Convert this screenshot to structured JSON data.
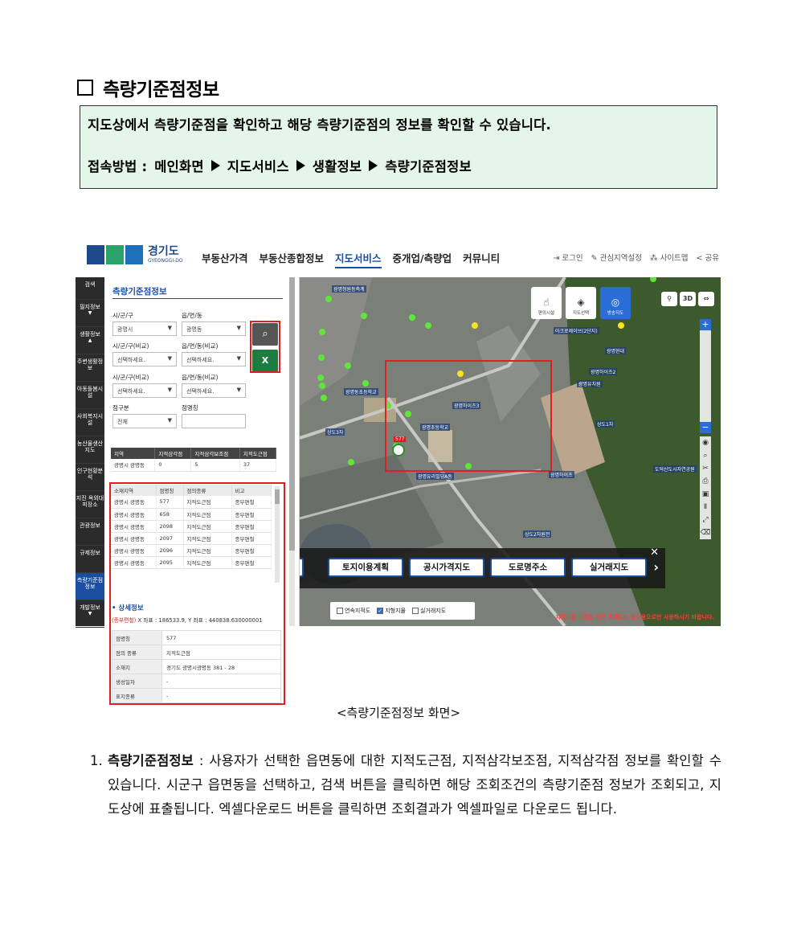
{
  "doc": {
    "title": "측량기준점정보",
    "intro": "지도상에서 측량기준점을 확인하고 해당 측량기준점의 정보를 확인할 수 있습니다.",
    "access_label": "접속방법 :",
    "access_path": [
      "메인화면",
      "지도서비스",
      "생활정보",
      "측량기준점정보"
    ],
    "caption": "<측량기준점정보 화면>",
    "item_number": "1.",
    "item_term": "측량기준점정보",
    "item_text": " : 사용자가 선택한 읍면동에 대한 지적도근점, 지적삼각보조점, 지적삼각점 정보를 확인할 수 있습니다. 시군구 읍면동을 선택하고, 검색 버튼을 클릭하면 해당 조회조건의 측량기준점 정보가 조회되고, 지도상에 표출됩니다. 엑셀다운로드 버튼을 클릭하면 조회결과가 엑셀파일로 다운로드 됩니다."
  },
  "screen": {
    "logo_ko": "경기도",
    "logo_en": "GYEONGGI-DO",
    "menu": [
      "부동산가격",
      "부동산종합정보",
      "지도서비스",
      "중개업/측량업",
      "커뮤니티"
    ],
    "util": [
      "로그인",
      "관심지역설정",
      "사이트맵",
      "공유"
    ],
    "lnb": [
      "검색",
      "필지정보",
      "생활정보",
      "주변생활정보",
      "아동돌봄시설",
      "사회복지시설",
      "농산물생산지도",
      "인구현황분석",
      "지진 옥외대피장소",
      "관광정보",
      "규제정보",
      "측량기준점정보",
      "개발정보"
    ],
    "panel_title": "측량기준점정보",
    "labels": {
      "sigungu": "시/군/구",
      "emd": "읍/면/동",
      "sigungu_cmp": "시/군/구(비교)",
      "emd_cmp": "읍/면/동(비교)",
      "point_kind": "점구분",
      "point_name": "점명칭"
    },
    "values": {
      "sigungu": "광명시",
      "emd": "광명동",
      "placeholder": "선택하세요.",
      "point_kind": "전체"
    },
    "summary": {
      "headers": [
        "지역",
        "지적삼각점",
        "지적삼각보조점",
        "지적도근점"
      ],
      "row": [
        "광명시 광명동",
        "0",
        "5",
        "37"
      ]
    },
    "list": {
      "headers": [
        "소재지역",
        "점명칭",
        "점의종류",
        "비고"
      ],
      "rows": [
        [
          "광명시 광명동",
          "577",
          "지적도근점",
          "종부편철"
        ],
        [
          "광명시 광명동",
          "658",
          "지적도근점",
          "종부편철"
        ],
        [
          "광명시 광명동",
          "2098",
          "지적도근점",
          "종부편철"
        ],
        [
          "광명시 광명동",
          "2097",
          "지적도근점",
          "종부편철"
        ],
        [
          "광명시 광명동",
          "2096",
          "지적도근점",
          "종부편철"
        ],
        [
          "광명시 광명동",
          "2095",
          "지적도근점",
          "종부편철"
        ]
      ]
    },
    "detail_title": "상세정보",
    "coord_tag": "(종부편철)",
    "coord_text": " X 좌표 : 186533.9, Y 좌표 : 440838.630000001",
    "detail_rows": [
      [
        "점명칭",
        "577"
      ],
      [
        "점의 종류",
        "지적도근점"
      ],
      [
        "소재지",
        "경기도 광명시광명동 381 - 28"
      ],
      [
        "생성일자",
        "-"
      ],
      [
        "표지종류",
        "-"
      ]
    ],
    "map": {
      "quick": [
        "편의시설",
        "지도선택",
        "방송지도"
      ],
      "tools": [
        "3D"
      ],
      "bar_buttons": [
        "토지이용계획",
        "공시가격지도",
        "도로명주소",
        "실거래지도"
      ],
      "layers": [
        "연속지적도",
        "지형지물",
        "실거래지도"
      ],
      "warning": "지적도를 포함한 모든 주제도는 참고용으로만 사용하시기 바랍니다.",
      "labels": [
        "광명청원동측계",
        "아크로제이브(2단지)",
        "광명현대",
        "광명유치원",
        "광명하이츠2",
        "광명동초등학교",
        "광명초등학교",
        "상도1차",
        "상도3차",
        "광명하이츠3",
        "광명유리빌딩A동",
        "광명하이츠",
        "상도2차원전",
        "도덕산도시자연공원",
        "577"
      ]
    }
  }
}
